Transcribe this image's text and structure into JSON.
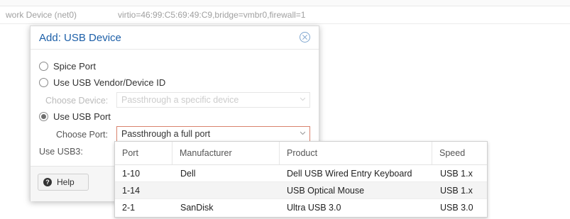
{
  "background": {
    "row_key": "work Device (net0)",
    "row_value": "virtio=46:99:C5:69:49:C9,bridge=vmbr0,firewall=1"
  },
  "dialog": {
    "title": "Add: USB Device",
    "close_icon": "close-circle-icon",
    "options": {
      "spice": "Spice Port",
      "vendor": "Use USB Vendor/Device ID",
      "port": "Use USB Port",
      "selected": "port"
    },
    "choose_device": {
      "label": "Choose Device:",
      "placeholder": "Passthrough a specific device",
      "disabled": true
    },
    "choose_port": {
      "label": "Choose Port:",
      "value": "Passthrough a full port"
    },
    "use_usb3_label": "Use USB3:",
    "help_label": "Help"
  },
  "dropdown": {
    "columns": [
      "Port",
      "Manufacturer",
      "Product",
      "Speed"
    ],
    "rows": [
      [
        "1-10",
        "Dell",
        "Dell USB Wired Entry Keyboard",
        "USB 1.x"
      ],
      [
        "1-14",
        "",
        "USB Optical Mouse",
        "USB 1.x"
      ],
      [
        "2-1",
        "SanDisk",
        "Ultra USB 3.0",
        "USB 3.0"
      ]
    ]
  },
  "colors": {
    "title": "#1c5fa8",
    "focus_border": "#d9826d"
  }
}
